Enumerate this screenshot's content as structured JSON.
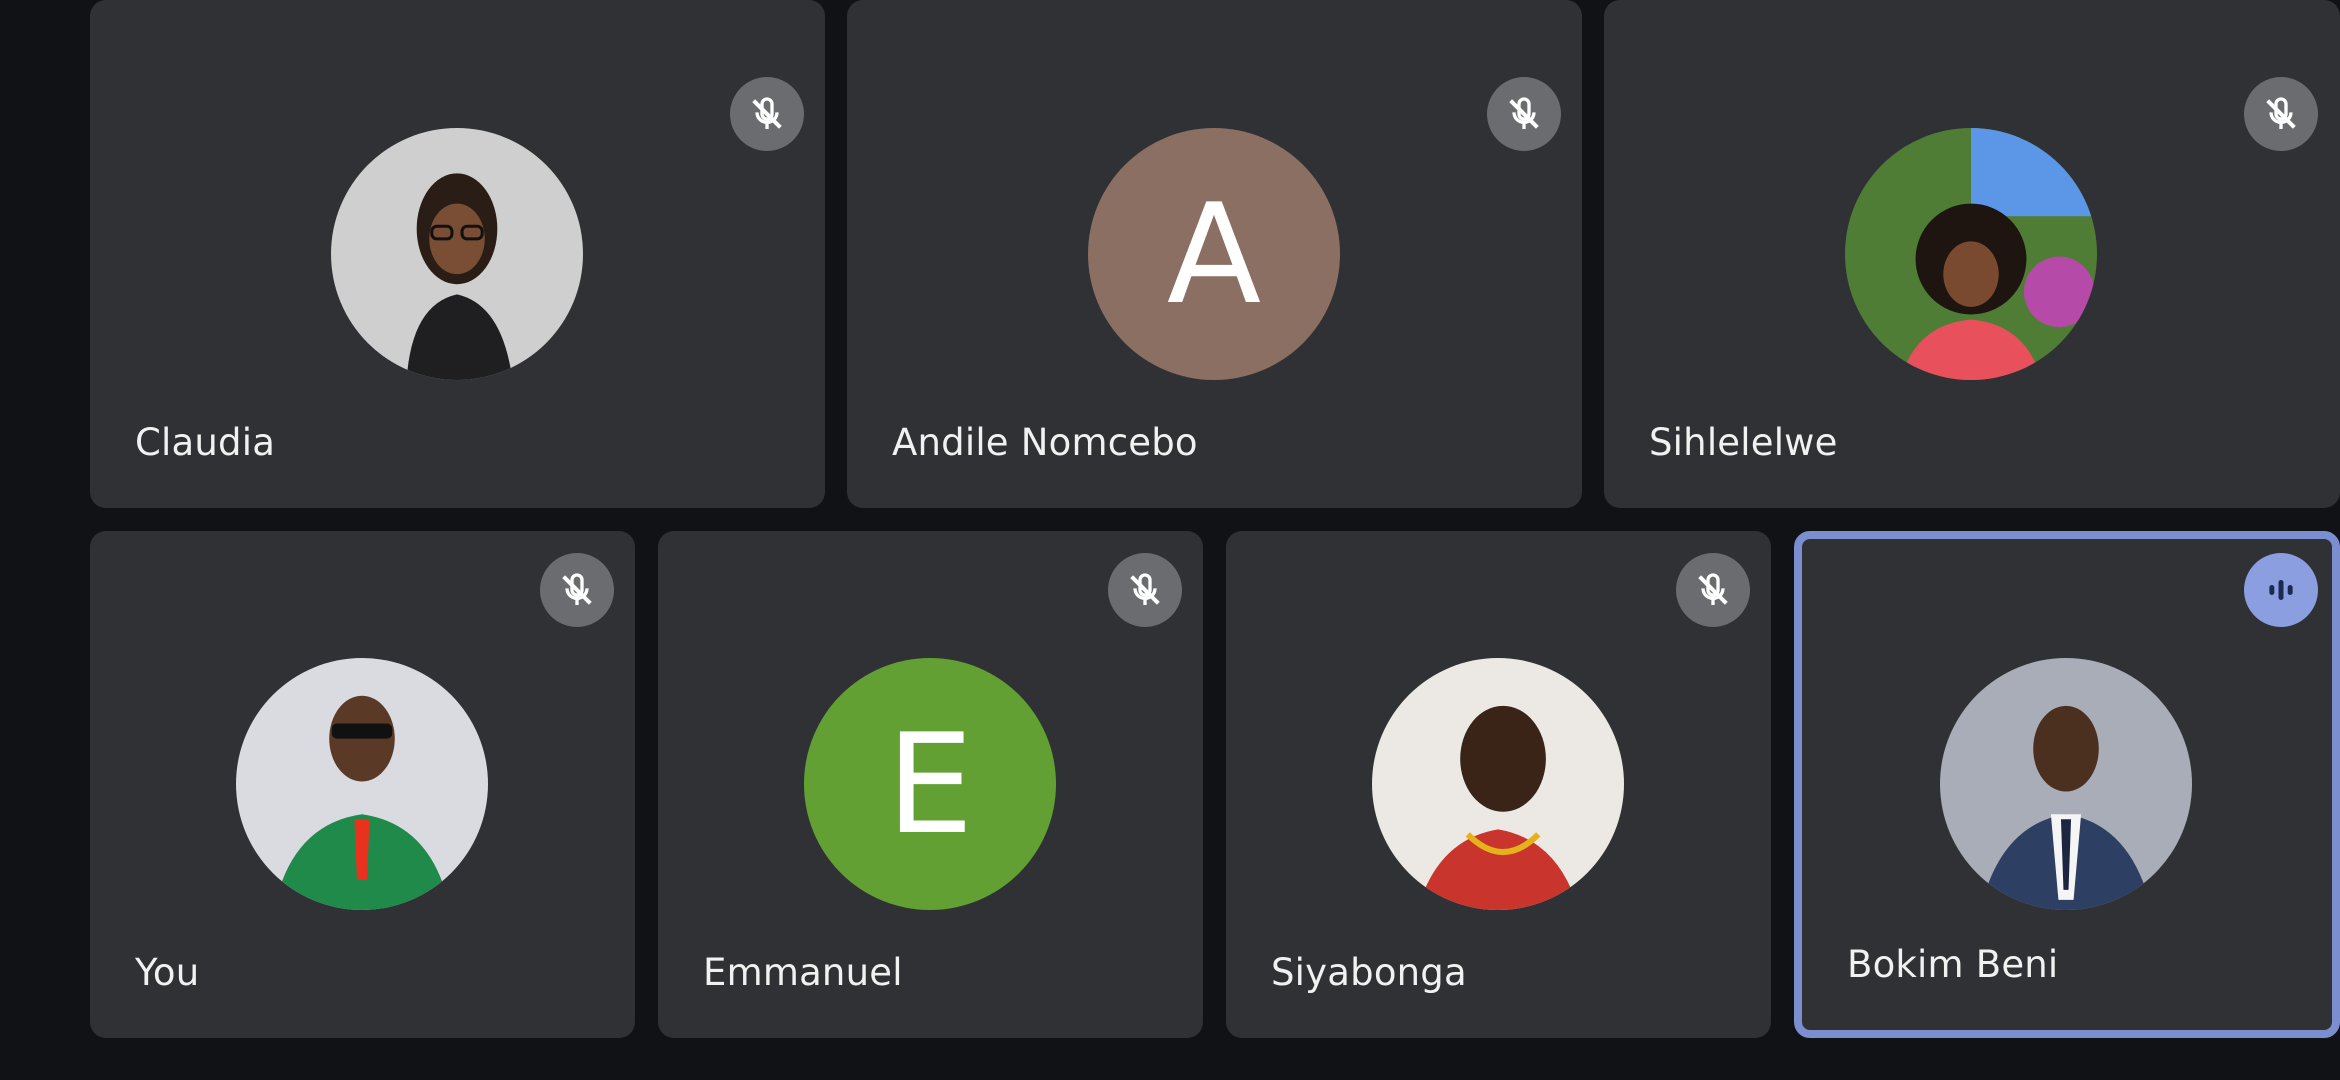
{
  "participants": [
    {
      "name": "Claudia",
      "avatar": "photo",
      "mic": "muted-mic-icon"
    },
    {
      "name": "Andile Nomcebo",
      "avatar": "letter",
      "initial": "A",
      "avatar_color": "#8b6f63",
      "mic": "muted-mic-icon"
    },
    {
      "name": "Sihlelelwe",
      "avatar": "photo",
      "mic": "muted-mic-icon"
    },
    {
      "name": "You",
      "avatar": "photo",
      "mic": "muted-mic-icon"
    },
    {
      "name": "Emmanuel",
      "avatar": "letter",
      "initial": "E",
      "avatar_color": "#63a034",
      "mic": "muted-mic-icon"
    },
    {
      "name": "Siyabonga",
      "avatar": "photo",
      "mic": "muted-mic-icon"
    },
    {
      "name": "Bokim Beni",
      "avatar": "photo",
      "mic": "speaking-indicator-icon",
      "active_speaker": true
    }
  ],
  "colors": {
    "background": "#111216",
    "tile": "#303135",
    "active_border": "#7b8fd0",
    "mic_badge": "#6b6c70",
    "speaking_badge": "#8a9ee0"
  }
}
